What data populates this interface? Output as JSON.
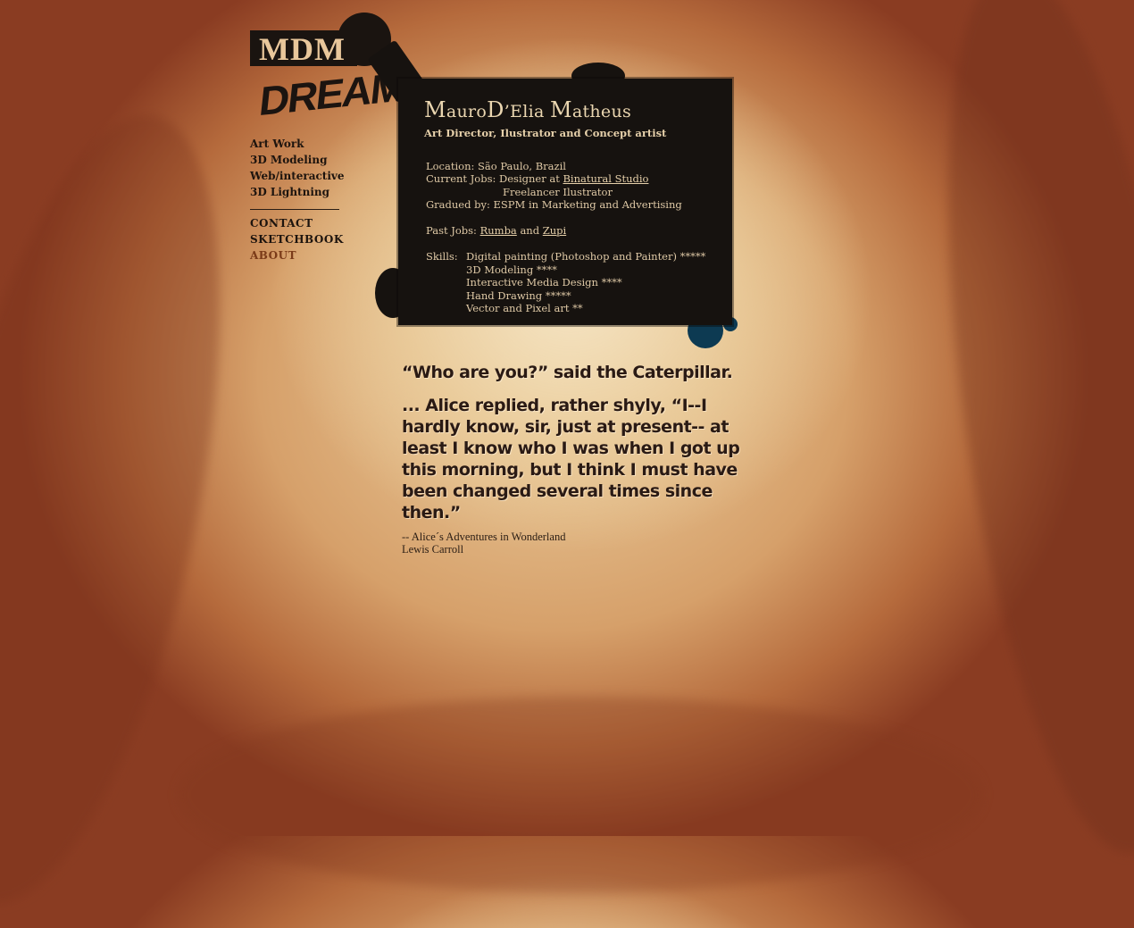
{
  "logo": {
    "top": "MDM",
    "bottom": "DREAM"
  },
  "nav": {
    "items": [
      "Art Work",
      "3D Modeling",
      "Web/interactive",
      "3D Lightning"
    ],
    "contact": "CONTACT",
    "sketchbook": "SKETCHBOOK",
    "about": "ABOUT"
  },
  "profile": {
    "name_m1": "M",
    "name_p1": "auro",
    "name_d": "D",
    "name_p2": "’Elia",
    "name_m2": "M",
    "name_p3": "atheus",
    "role": "Art Director, Ilustrator and Concept artist",
    "location": "Location: São Paulo, Brazil",
    "current_prefix": "Current Jobs: Designer at",
    "current_link": "Binatural Studio",
    "current_second": "Freelancer Ilustrator",
    "graduated": "Gradued by: ESPM in Marketing and Advertising",
    "past_prefix": "Past Jobs:",
    "past_link1": "Rumba",
    "past_and": "and",
    "past_link2": "Zupi",
    "skills_label": "Skills:",
    "skills": [
      "Digital painting (Photoshop and Painter) *****",
      "3D Modeling ****",
      "Interactive Media Design ****",
      "Hand Drawing *****",
      "Vector and Pixel art **"
    ]
  },
  "quote": {
    "line1": "“Who are you?” said the Caterpillar.",
    "line2": "... Alice replied, rather shyly, “I--I hardly know, sir, just at present-- at least I know who I was when I got up this morning, but I think I must have been changed several times since then.”",
    "source_title": "-- Alice´s Adventures in Wonderland",
    "source_author": "Lewis Carroll"
  }
}
